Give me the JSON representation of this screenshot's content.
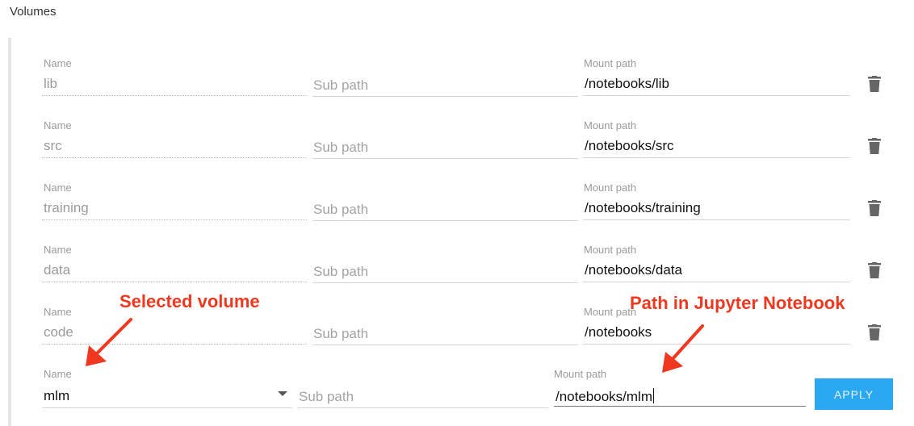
{
  "section": {
    "title": "Volumes"
  },
  "volumes": [
    {
      "name_label": "Name",
      "name": "lib",
      "subpath_placeholder": "Sub path",
      "mount_label": "Mount path",
      "mount_path": "/notebooks/lib"
    },
    {
      "name_label": "Name",
      "name": "src",
      "subpath_placeholder": "Sub path",
      "mount_label": "Mount path",
      "mount_path": "/notebooks/src"
    },
    {
      "name_label": "Name",
      "name": "training",
      "subpath_placeholder": "Sub path",
      "mount_label": "Mount path",
      "mount_path": "/notebooks/training"
    },
    {
      "name_label": "Name",
      "name": "data",
      "subpath_placeholder": "Sub path",
      "mount_label": "Mount path",
      "mount_path": "/notebooks/data"
    },
    {
      "name_label": "Name",
      "name": "code",
      "subpath_placeholder": "Sub path",
      "mount_label": "Mount path",
      "mount_path": "/notebooks"
    }
  ],
  "new_volume": {
    "name_label": "Name",
    "name": "mlm",
    "subpath_placeholder": "Sub path",
    "mount_label": "Mount path",
    "mount_path": "/notebooks/mlm",
    "apply_label": "APPLY"
  },
  "annotations": {
    "selected_volume": "Selected volume",
    "path_in_notebook": "Path in Jupyter Notebook"
  },
  "icons": {
    "delete": "trash-icon",
    "dropdown": "caret-down-icon"
  },
  "colors": {
    "accent": "#2aa9f2",
    "annotation": "#f0371f"
  }
}
